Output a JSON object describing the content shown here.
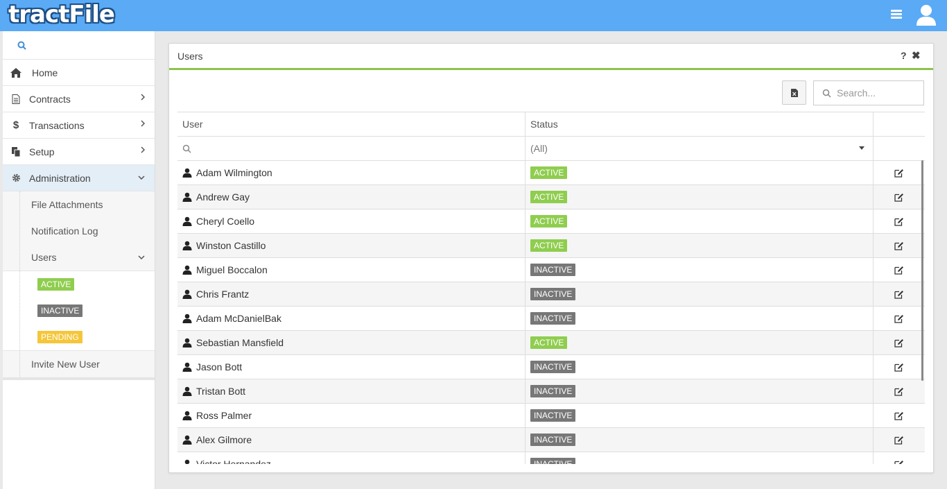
{
  "app": {
    "logo_text": "tractFile"
  },
  "sidebar": {
    "items": [
      {
        "label": "Home",
        "icon": "home-icon"
      },
      {
        "label": "Contracts",
        "icon": "document-icon"
      },
      {
        "label": "Transactions",
        "icon": "dollar-icon"
      },
      {
        "label": "Setup",
        "icon": "copy-icon"
      },
      {
        "label": "Administration",
        "icon": "gear-icon"
      }
    ],
    "admin_sub": [
      "File Attachments",
      "Notification Log",
      "Users"
    ],
    "user_filters": [
      "ACTIVE",
      "INACTIVE",
      "PENDING"
    ],
    "invite": "Invite New User"
  },
  "panel": {
    "title": "Users",
    "help": "?",
    "close": "✖",
    "search_placeholder": "Search...",
    "columns": {
      "user": "User",
      "status": "Status"
    },
    "status_filter": "(All)",
    "rows": [
      {
        "name": "Adam Wilmington",
        "status": "ACTIVE"
      },
      {
        "name": "Andrew Gay",
        "status": "ACTIVE"
      },
      {
        "name": "Cheryl Coello",
        "status": "ACTIVE"
      },
      {
        "name": "Winston Castillo",
        "status": "ACTIVE"
      },
      {
        "name": "Miguel Boccalon",
        "status": "INACTIVE"
      },
      {
        "name": "Chris Frantz",
        "status": "INACTIVE"
      },
      {
        "name": "Adam McDanielBak",
        "status": "INACTIVE"
      },
      {
        "name": "Sebastian Mansfield",
        "status": "ACTIVE"
      },
      {
        "name": "Jason Bott",
        "status": "INACTIVE"
      },
      {
        "name": "Tristan Bott",
        "status": "INACTIVE"
      },
      {
        "name": "Ross Palmer",
        "status": "INACTIVE"
      },
      {
        "name": "Alex Gilmore",
        "status": "INACTIVE"
      },
      {
        "name": "Victor Hernandez",
        "status": "INACTIVE"
      }
    ]
  },
  "colors": {
    "topbar": "#5aaaf5",
    "active": "#8fcd4f",
    "inactive": "#777777",
    "pending": "#f5c63a",
    "accent_line": "#8cc44d"
  }
}
